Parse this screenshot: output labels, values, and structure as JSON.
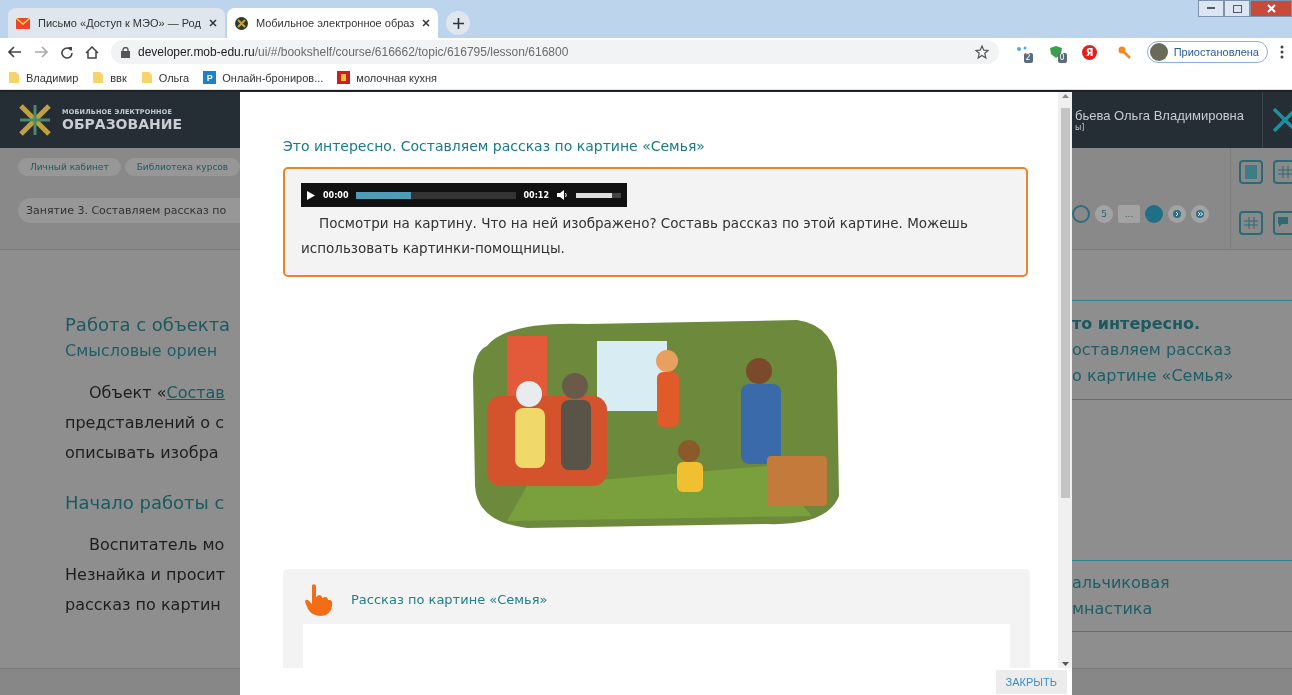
{
  "browser": {
    "tabs": [
      {
        "title": "Письмо «Доступ к МЭО» — Род",
        "selected": false
      },
      {
        "title": "Мобильное электронное образ",
        "selected": true
      }
    ],
    "address": {
      "host": "developer.mob-edu.ru",
      "path": "/ui/#/bookshelf/course/616662/topic/616795/lesson/616800"
    },
    "extensions": [
      {
        "kind": "dots",
        "badge": "2"
      },
      {
        "kind": "shield",
        "badge": "0"
      },
      {
        "kind": "yandex",
        "letter": "Я"
      },
      {
        "kind": "key"
      }
    ],
    "profile": "Приостановлена",
    "bookmarks": [
      {
        "kind": "folder",
        "label": "Владимир"
      },
      {
        "kind": "folder",
        "label": "ввк"
      },
      {
        "kind": "folder",
        "label": "Ольга"
      },
      {
        "kind": "letter",
        "letter": "P",
        "label": "Онлайн-брониров..."
      },
      {
        "kind": "emblem",
        "label": "молочная кухня"
      }
    ]
  },
  "site": {
    "logo_small": "МОБИЛЬНОЕ ЭЛЕКТРОННОЕ",
    "logo_big": "ОБРАЗОВАНИЕ",
    "user_name": "бьева Ольга Владимировна",
    "user_role": "ы]",
    "breadcrumbs": [
      "Личный кабинет",
      "Библиотека курсов"
    ],
    "lesson": "Занятие 3. Составляем рассказ по",
    "pagination": [
      {
        "kind": "ring"
      },
      {
        "kind": "page",
        "label": "5"
      },
      {
        "kind": "more",
        "label": "..."
      },
      {
        "kind": "current"
      },
      {
        "kind": "next"
      },
      {
        "kind": "last"
      }
    ],
    "sections": [
      {
        "heading": "Работа с объекта",
        "subheading": "Смысловые ориен",
        "lines": [
          {
            "text": "Объект «",
            "link": "Состав"
          },
          {
            "text": "представлений о с"
          },
          {
            "text": "описывать изобра"
          }
        ]
      },
      {
        "heading": "Начало работы с",
        "lines": [
          {
            "text": "Воспитатель мо"
          },
          {
            "text": "Незнайка и просит"
          },
          {
            "text": "рассказ по картин"
          }
        ]
      }
    ],
    "related": [
      {
        "bold": "то интересно.",
        "lines": [
          "оставляем рассказ",
          "о картине «Семья»"
        ]
      },
      {
        "lines": [
          "альчиковая",
          "мнастика"
        ]
      }
    ]
  },
  "modal": {
    "title": "Это интересно. Составляем рассказ по картине «Семья»",
    "audio": {
      "current": "00:00",
      "duration": "00:12",
      "level": 0.34,
      "volume": {
        "level": 0.8
      }
    },
    "task": "Посмотри на картину. Что на ней изображено? Составь рассказ по этой картине. Можешь использовать картинки-помощницы.",
    "hint": {
      "title": "Рассказ по картине «Семья»"
    },
    "close": "ЗАКРЫТЬ"
  }
}
